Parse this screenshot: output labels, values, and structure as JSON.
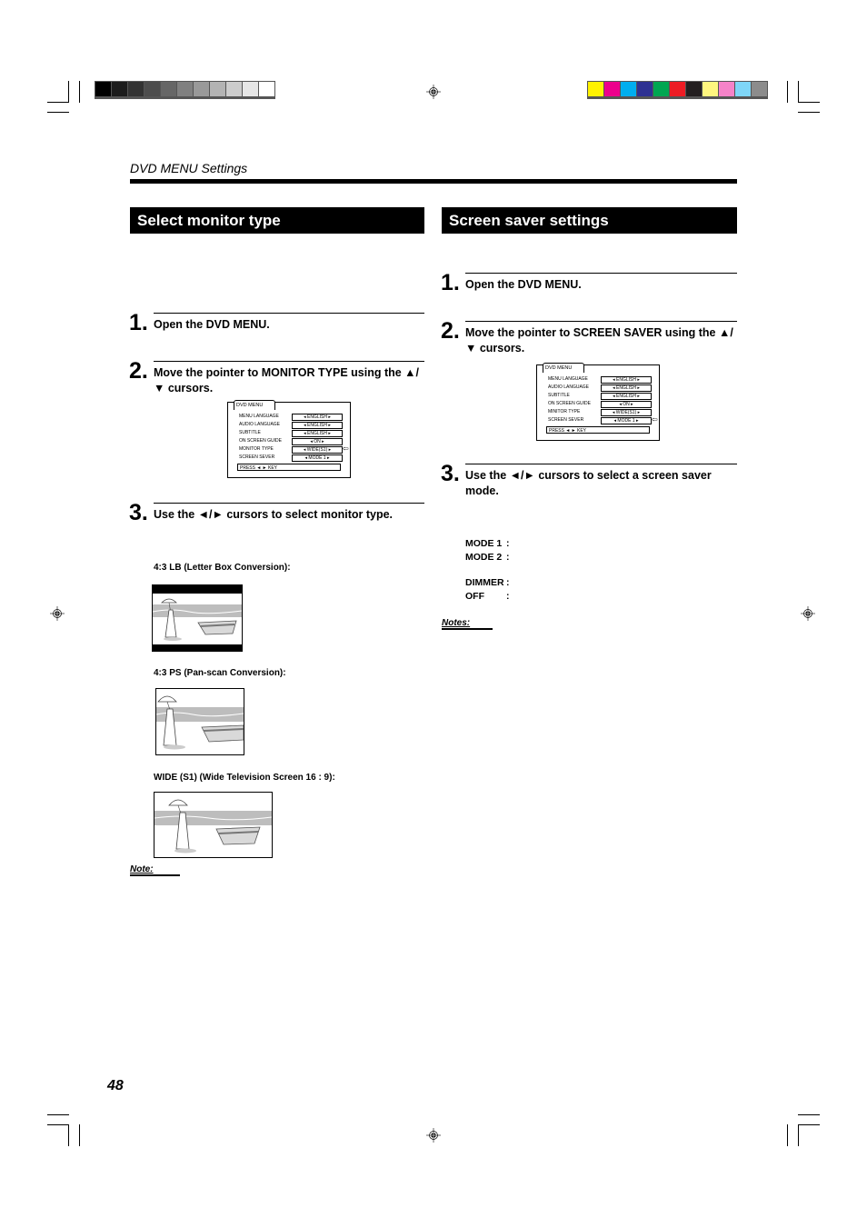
{
  "print_marks": {
    "gray_bar": [
      "#000000",
      "#1c1c1c",
      "#333333",
      "#4d4d4d",
      "#666666",
      "#808080",
      "#999999",
      "#b3b3b3",
      "#cccccc",
      "#e6e6e6",
      "#ffffff"
    ],
    "color_bar": [
      "#fff200",
      "#ec008c",
      "#00aeef",
      "#2e3192",
      "#00a651",
      "#ed1c24",
      "#231f20",
      "#fff67f",
      "#f583c8",
      "#7fd6f7",
      "#8c8c8c"
    ]
  },
  "header": {
    "section_label": "DVD MENU Settings"
  },
  "left": {
    "title": "Select monitor type",
    "steps": [
      {
        "num": "1.",
        "text": "Open the DVD MENU."
      },
      {
        "num": "2.",
        "text": "Move the pointer to MONITOR TYPE using the ▲/▼ cursors."
      },
      {
        "num": "3.",
        "text": "Use the ◄/► cursors to select monitor type."
      }
    ],
    "menu": {
      "tab": "DVD MENU",
      "rows": [
        {
          "label": "MENU LANGUAGE",
          "value": "ENGLISH"
        },
        {
          "label": "AUDIO LANGUAGE",
          "value": "ENGLISH"
        },
        {
          "label": "SUBTITLE",
          "value": "ENGLISH"
        },
        {
          "label": "ON SCREEN GUIDE",
          "value": "ON"
        },
        {
          "label": "MONITOR TYPE",
          "value": "WIDE(S1)"
        },
        {
          "label": "SCREEN SEVER",
          "value": "MODE 1"
        }
      ],
      "press": "PRESS ◄ ► KEY",
      "pointer_row": "MONITOR TYPE"
    },
    "pictures": [
      {
        "caption": "4:3 LB (Letter Box Conversion):"
      },
      {
        "caption": "4:3 PS (Pan-scan Conversion):"
      },
      {
        "caption": "WIDE (S1) (Wide Television Screen 16 : 9):"
      }
    ],
    "note_label": "Note:"
  },
  "right": {
    "title": "Screen saver settings",
    "steps": [
      {
        "num": "1.",
        "text": "Open the DVD MENU."
      },
      {
        "num": "2.",
        "text": "Move the pointer to SCREEN SAVER using the ▲/▼ cursors."
      },
      {
        "num": "3.",
        "text": "Use the ◄/► cursors to select a screen saver mode."
      }
    ],
    "menu": {
      "tab": "DVD MENU",
      "rows": [
        {
          "label": "MENU LANGUAGE",
          "value": "ENGLISH"
        },
        {
          "label": "AUDIO LANGUAGE",
          "value": "ENGLISH"
        },
        {
          "label": "SUBTITLE",
          "value": "ENGLISH"
        },
        {
          "label": "ON SCREEN GUIDE",
          "value": "ON"
        },
        {
          "label": "MINITOR TYPE",
          "value": "WIDE(S1)"
        },
        {
          "label": "SCREEN SEVER",
          "value": "MODE 1"
        }
      ],
      "press": "PRESS ◄ ► KEY",
      "pointer_row": "SCREEN SEVER"
    },
    "modes": [
      {
        "label": "MODE 1",
        "sep": ":"
      },
      {
        "label": "MODE 2",
        "sep": ":"
      },
      {
        "label": "DIMMER",
        "sep": ":"
      },
      {
        "label": "OFF",
        "sep": ":"
      }
    ],
    "notes_label": "Notes:"
  },
  "footer": {
    "page_number": "48"
  }
}
